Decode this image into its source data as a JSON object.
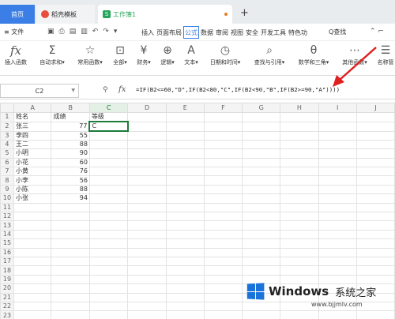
{
  "titlebar": {
    "home_tab": "首页",
    "template_tab": "稻壳模板",
    "workbook_tab": "工作簿1",
    "add_tab": "+"
  },
  "menubar": {
    "file": "≡ 文件",
    "tabs": [
      "插入",
      "页面布局",
      "公式",
      "数据",
      "审阅",
      "视图",
      "安全",
      "开发工具",
      "特色功"
    ],
    "selected_tab": "公式",
    "search": "Q查找"
  },
  "ribbon": {
    "buttons": [
      {
        "label": "插入函数",
        "icon": "fx-icon"
      },
      {
        "label": "自动求和▾",
        "icon": "sum-icon"
      },
      {
        "label": "常用函数▾",
        "icon": "star-function-icon"
      },
      {
        "label": "全部▾",
        "icon": "all-functions-icon"
      },
      {
        "label": "财务▾",
        "icon": "finance-icon"
      },
      {
        "label": "逻辑▾",
        "icon": "logic-icon"
      },
      {
        "label": "文本▾",
        "icon": "text-icon"
      },
      {
        "label": "日期和时间▾",
        "icon": "date-time-icon"
      },
      {
        "label": "查找与引用▾",
        "icon": "lookup-icon"
      },
      {
        "label": "数学和三角▾",
        "icon": "math-icon"
      },
      {
        "label": "其他函数▾",
        "icon": "other-functions-icon"
      },
      {
        "label": "名称管",
        "icon": "name-manager-icon"
      }
    ]
  },
  "formula_bar": {
    "name_box": "C2",
    "formula": "=IF(B2<=60,\"D\",IF(B2<80,\"C\",IF(B2<90,\"B\",IF(B2>=90,\"A\"))))"
  },
  "sheet": {
    "columns": [
      "A",
      "B",
      "C",
      "D",
      "E",
      "F",
      "G",
      "H",
      "I",
      "J"
    ],
    "selected_column": "C",
    "active_cell": "C2",
    "rows": [
      [
        "姓名",
        "成绩",
        "等级"
      ],
      [
        "张三",
        "77",
        "C"
      ],
      [
        "李四",
        "55",
        ""
      ],
      [
        "王二",
        "88",
        ""
      ],
      [
        "小明",
        "90",
        ""
      ],
      [
        "小花",
        "60",
        ""
      ],
      [
        "小黄",
        "76",
        ""
      ],
      [
        "小李",
        "56",
        ""
      ],
      [
        "小陈",
        "88",
        ""
      ],
      [
        "小张",
        "94",
        ""
      ]
    ],
    "total_rows": 23
  },
  "watermark": {
    "brand": "Windows",
    "cn": "系统之家",
    "url": "www.bjjmlv.com"
  },
  "colors": {
    "accent_blue": "#3b7fe6",
    "selection_green": "#1e7a3c",
    "annotation_red": "#e02020"
  }
}
